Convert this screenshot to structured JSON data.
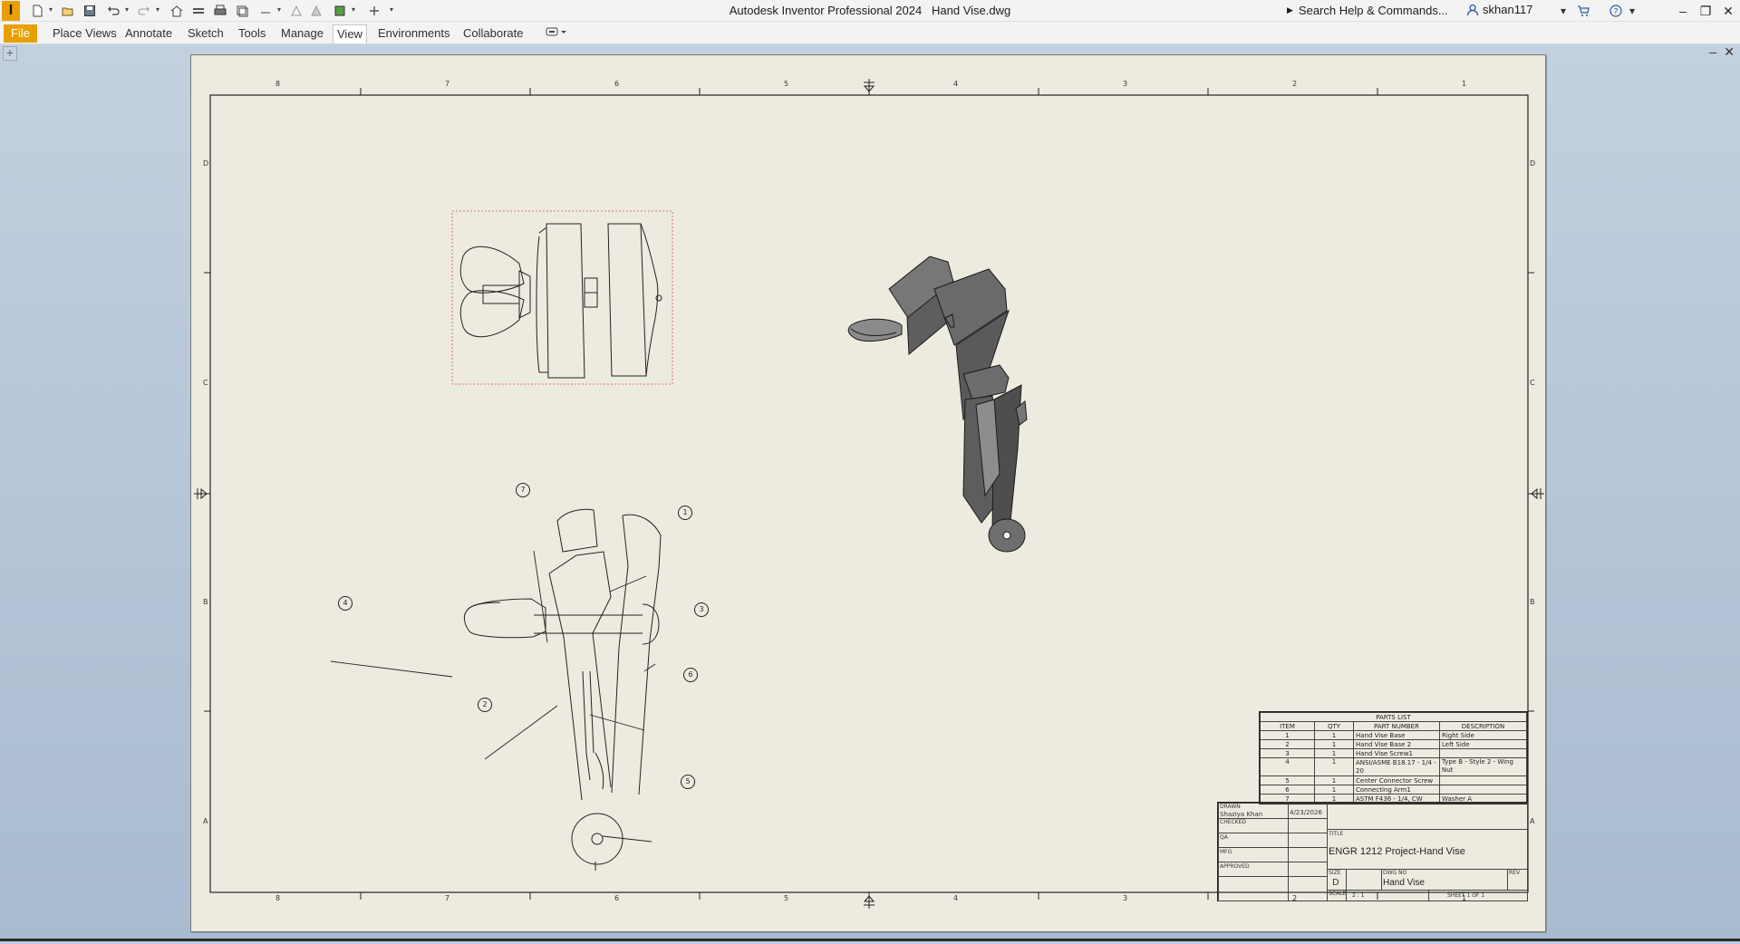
{
  "window": {
    "title": "Autodesk Inventor Professional 2024",
    "document": "Hand Vise.dwg",
    "search_label": "Search Help & Commands...",
    "user": "skhan117",
    "logo": "I"
  },
  "quick_access": {
    "icons": [
      "new-icon",
      "open-icon",
      "save-icon",
      "undo-icon",
      "redo-icon",
      "home-icon",
      "update-icon",
      "print-icon",
      "project-icon",
      "measure-icon",
      "appearance-icon",
      "material-icon",
      "add-icon"
    ]
  },
  "ribbon": {
    "tabs": [
      "File",
      "Place Views",
      "Annotate",
      "Sketch",
      "Tools",
      "Manage",
      "View",
      "Environments",
      "Collaborate"
    ],
    "active_tab": "View"
  },
  "sheet": {
    "zone_numbers": [
      "8",
      "7",
      "6",
      "5",
      "4",
      "3",
      "2",
      "1"
    ],
    "zone_letters": [
      "D",
      "C",
      "B",
      "A"
    ]
  },
  "balloons": [
    "1",
    "2",
    "3",
    "4",
    "5",
    "6",
    "7"
  ],
  "parts_list": {
    "title": "PARTS LIST",
    "headers": [
      "ITEM",
      "QTY",
      "PART NUMBER",
      "DESCRIPTION"
    ],
    "rows": [
      [
        "1",
        "1",
        "Hand Vise Base",
        "Right Side"
      ],
      [
        "2",
        "1",
        "Hand Vise Base 2",
        "Left Side"
      ],
      [
        "3",
        "1",
        "Hand Vise Screw1",
        ""
      ],
      [
        "4",
        "1",
        "ANSI/ASME B18.17 - 1/4 - 20",
        "Type B - Style 2 - Wing Nut"
      ],
      [
        "5",
        "1",
        "Center Connector Screw",
        ""
      ],
      [
        "6",
        "1",
        "Connecting Arm1",
        ""
      ],
      [
        "7",
        "1",
        "ASTM F436 - 1/4, CW",
        "Washer A"
      ]
    ]
  },
  "title_block": {
    "drawn_label": "DRAWN",
    "drawn_name": "Shaziya Khan",
    "drawn_date": "4/23/2026",
    "checked_label": "CHECKED",
    "qa_label": "QA",
    "mfg_label": "MFG",
    "approved_label": "APPROVED",
    "title_label": "TITLE",
    "title": "ENGR 1212 Project-Hand Vise",
    "size_label": "SIZE",
    "size": "D",
    "dwg_label": "DWG NO",
    "dwg_no": "Hand Vise",
    "rev_label": "REV",
    "scale_label": "SCALE",
    "scale": "2 : 1",
    "sheet": "SHEET 1  OF 1"
  }
}
